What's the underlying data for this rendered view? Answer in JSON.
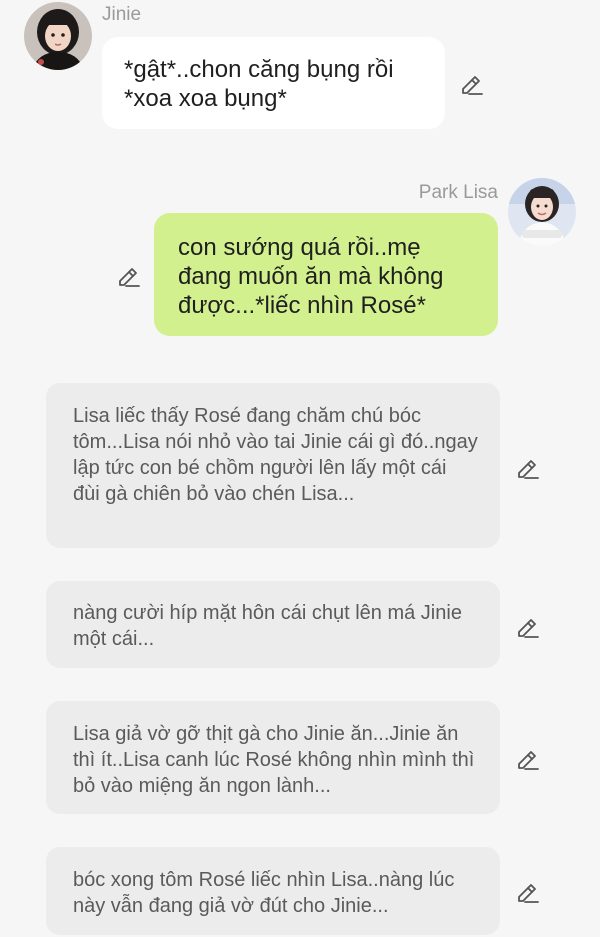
{
  "messages": [
    {
      "sender": "Jinie",
      "text": "*gật*..chon căng bụng rồi *xoa xoa bụng*"
    },
    {
      "sender": "Park Lisa",
      "text": "con sướng quá rồi..mẹ đang muốn ăn mà không được...*liếc nhìn Rosé*"
    }
  ],
  "narrations": [
    "Lisa liếc thấy Rosé đang chăm chú bóc tôm...Lisa nói nhỏ vào tai Jinie cái gì đó..ngay lập tức con bé chồm người lên lấy một cái đùi gà chiên bỏ vào chén Lisa...",
    "nàng cười híp mặt hôn cái chụt lên má Jinie một cái...",
    "Lisa giả vờ gỡ thịt gà cho Jinie ăn...Jinie ăn thì ít..Lisa canh lúc Rosé không nhìn mình thì bỏ vào miệng ăn ngon lành...",
    "bóc xong tôm Rosé liếc nhìn Lisa..nàng lúc này vẫn đang giả vờ đút cho Jinie..."
  ],
  "icons": {
    "edit": "pencil-edit-icon",
    "avatar_jinie": "avatar-photo",
    "avatar_lisa": "avatar-photo"
  },
  "colors": {
    "background": "#f6f6f6",
    "incoming_bubble": "#ffffff",
    "outgoing_bubble": "#d2f08e",
    "narration_bubble": "#ececec"
  }
}
